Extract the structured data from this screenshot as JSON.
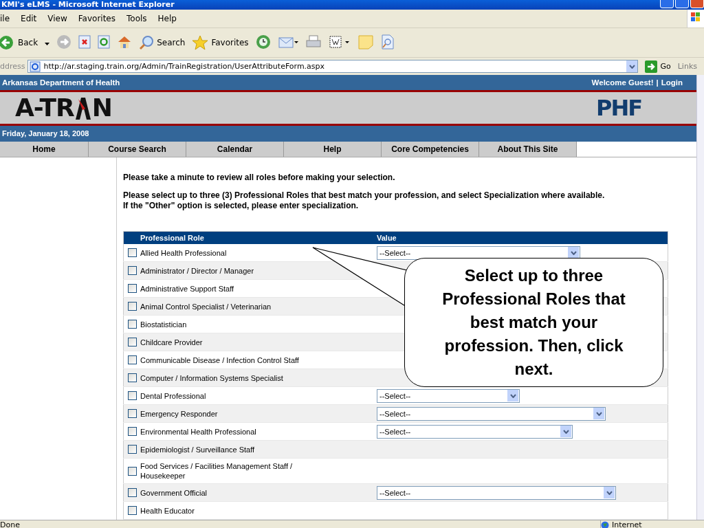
{
  "window": {
    "title": "KMI's eLMS - Microsoft Internet Explorer"
  },
  "menu": [
    "ile",
    "Edit",
    "View",
    "Favorites",
    "Tools",
    "Help"
  ],
  "toolbar": {
    "back": "Back",
    "search": "Search",
    "favorites": "Favorites"
  },
  "address": {
    "label": "ddress",
    "url": "http://ar.staging.train.org/Admin/TrainRegistration/UserAttributeForm.aspx",
    "go": "Go",
    "links": "Links"
  },
  "site": {
    "org": "Arkansas Department of Health",
    "welcome": "Welcome Guest!",
    "separator": "|",
    "login": "Login",
    "logo_left": "A-TR",
    "logo_right": "N",
    "partner_logo": "PHF",
    "date": "Friday, January 18, 2008"
  },
  "nav": [
    {
      "label": "Home",
      "selected": false
    },
    {
      "label": "Course Search",
      "selected": false
    },
    {
      "label": "Calendar",
      "selected": false
    },
    {
      "label": "Help",
      "selected": false
    },
    {
      "label": "Core Competencies",
      "selected": false
    },
    {
      "label": "About This Site",
      "selected": false
    }
  ],
  "intro": "Please take a minute to review all roles before making your selection.",
  "instructions": [
    "Please select up to three (3) Professional Roles that best match your profession, and select Specialization where available.",
    "If the \"Other\" option is selected, please enter specialization."
  ],
  "table": {
    "columns": [
      "Professional Role",
      "Value"
    ],
    "rows": [
      {
        "role": "Allied Health Professional",
        "checked": false,
        "select": "--Select--"
      },
      {
        "role": "Administrator / Director / Manager",
        "checked": false
      },
      {
        "role": "Administrative Support Staff",
        "checked": false
      },
      {
        "role": "Animal Control Specialist / Veterinarian",
        "checked": false
      },
      {
        "role": "Biostatistician",
        "checked": false
      },
      {
        "role": "Childcare Provider",
        "checked": false
      },
      {
        "role": "Communicable Disease / Infection Control Staff",
        "checked": false
      },
      {
        "role": "Computer / Information Systems Specialist",
        "checked": false
      },
      {
        "role": "Dental Professional",
        "checked": false,
        "select": "--Select--"
      },
      {
        "role": "Emergency Responder",
        "checked": false,
        "select": "--Select--"
      },
      {
        "role": "Environmental Health Professional",
        "checked": false,
        "select": "--Select--"
      },
      {
        "role": "Epidemiologist / Surveillance Staff",
        "checked": false
      },
      {
        "role": "Food Services / Facilities Management Staff / Housekeeper",
        "checked": false
      },
      {
        "role": "Government Official",
        "checked": false,
        "select": "--Select--"
      },
      {
        "role": "Health Educator",
        "checked": false
      }
    ]
  },
  "callout": "Select up to three Professional Roles that best match your profession. Then, click next.",
  "status_bar": {
    "text": "Done",
    "zone": "Internet"
  }
}
